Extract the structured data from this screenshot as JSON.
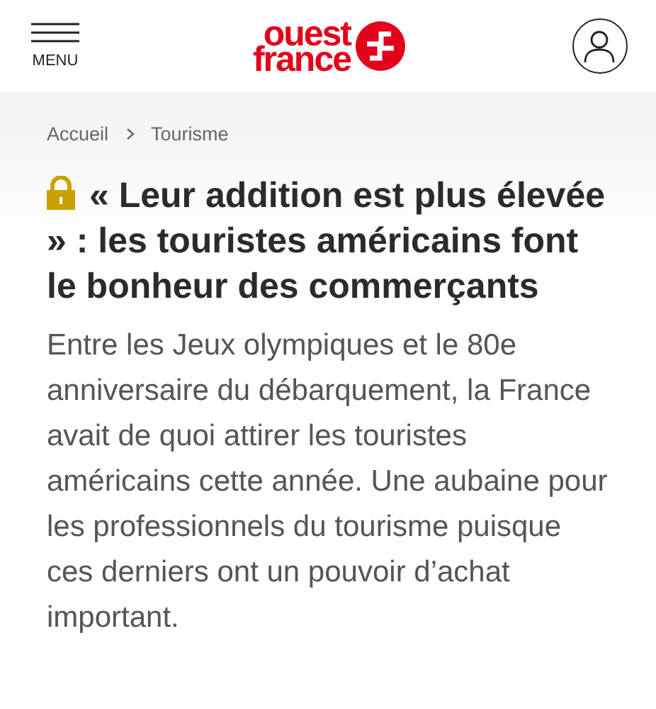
{
  "header": {
    "menu_label": "MENU",
    "logo": {
      "line_1": "ouest",
      "line_2": "france"
    }
  },
  "breadcrumb": [
    "Accueil",
    "Tourisme"
  ],
  "article": {
    "locked": true,
    "title": "« Leur addition est plus élevée » : les touristes américains font le bonheur des commerçants",
    "lead": "Entre les Jeux olympiques et le 80e anniversaire du débarquement, la France avait de quoi attirer les touristes américains cette année. Une aubaine pour les professionnels du tourisme puisque ces derniers ont un pouvoir d’achat important."
  }
}
